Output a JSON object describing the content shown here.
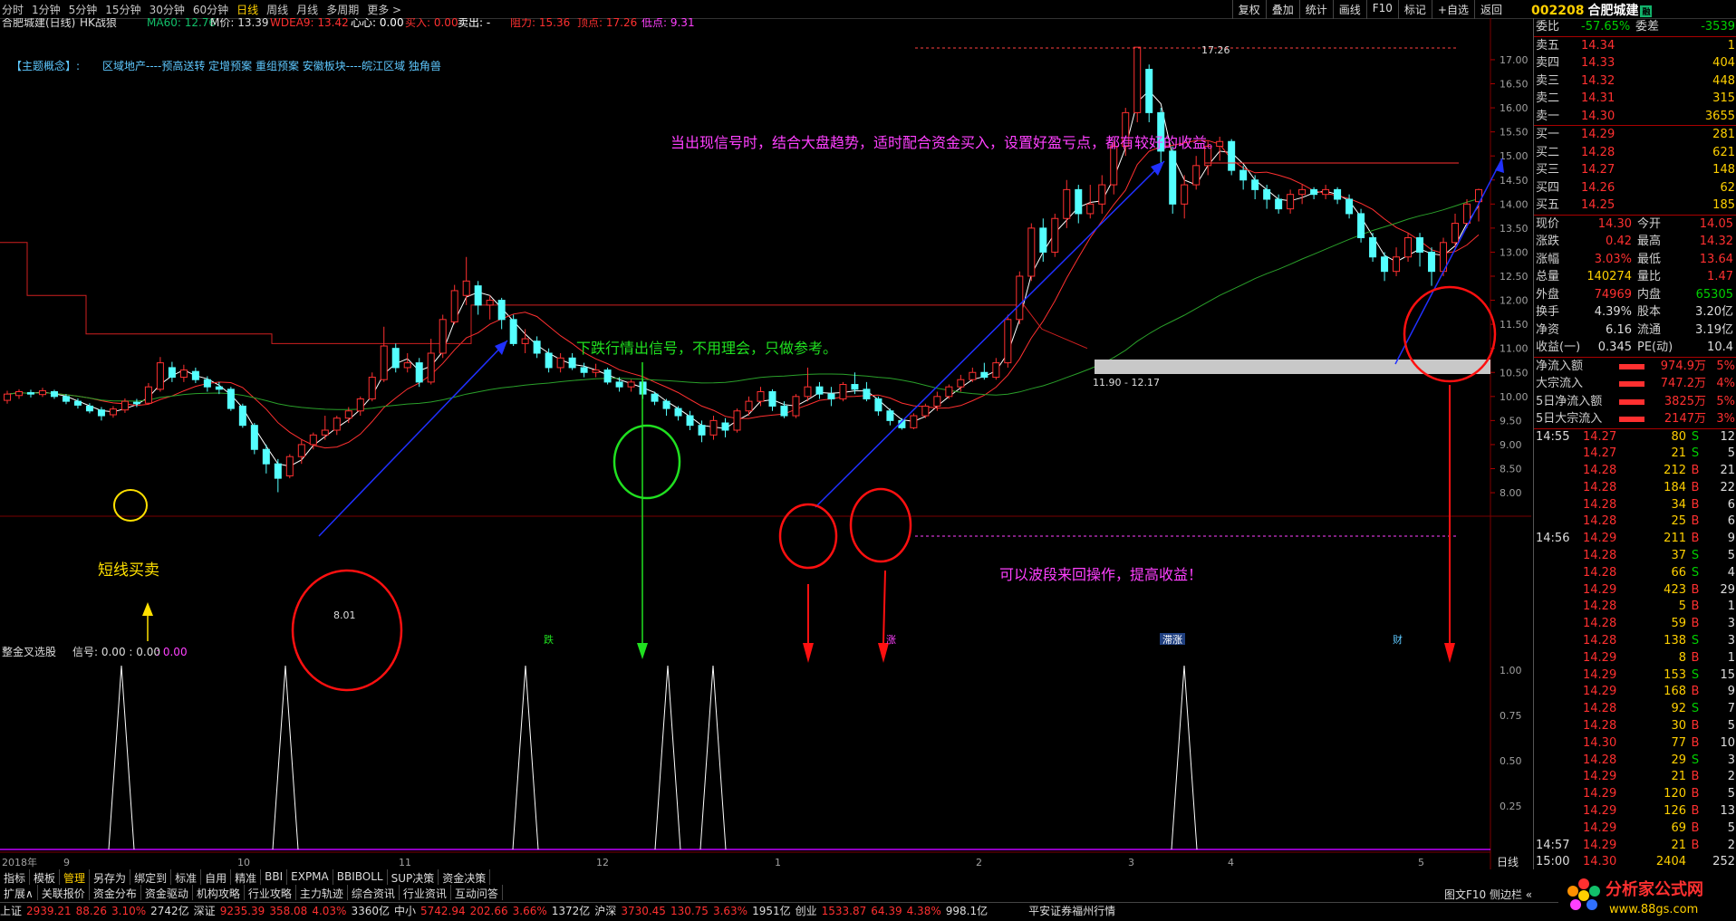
{
  "toolbar": {
    "periods": [
      "分时",
      "1分钟",
      "5分钟",
      "15分钟",
      "30分钟",
      "60分钟",
      "日线",
      "周线",
      "月线",
      "多周期",
      "更多 >"
    ],
    "active_period": "日线",
    "tools": [
      "复权",
      "叠加",
      "统计",
      "画线",
      "F10",
      "标记",
      "+自选",
      "返回"
    ]
  },
  "stock": {
    "code": "002208",
    "name": "合肥城建",
    "badge": "融"
  },
  "legend": {
    "title": "合肥城建(日线)",
    "indicator": "HK战狼",
    "ma60": "MA60: 12.76",
    "mprice": "M价: 13.39",
    "wdea9": "WDEA9: 13.42",
    "xinxin": "心心: 0.00",
    "buy": "买入: 0.00",
    "sell": "卖出: -",
    "zuli": "阻力: 15.36",
    "dingdian": "顶点: 17.26",
    "didian": "低点: 9.31"
  },
  "theme": {
    "label": "【主题概念】:",
    "text": "区域地产----预高送转 定增预案 重组预案 安徽板块----皖江区域 独角兽"
  },
  "annotations": {
    "a1": "当出现信号时，结合大盘趋势，适时配合资金买入，设置好盈亏点，都有较好的收益。",
    "a2": "下跌行情出信号，不用理会，只做参考。",
    "a3": "可以波段来回操作，提高收益！",
    "a4": "短线买卖",
    "peak": "17.26",
    "low": "8.01",
    "range": "11.90 - 12.17"
  },
  "sub_indicator": {
    "title": "整金叉选股",
    "signal": "信号: 0.00 : 0.00",
    "extra": ": 0.00"
  },
  "axis": {
    "main_ticks": [
      "17.00",
      "16.50",
      "16.00",
      "15.50",
      "15.00",
      "14.50",
      "14.00",
      "13.50",
      "13.00",
      "12.50",
      "12.00",
      "11.50",
      "11.00",
      "10.50",
      "10.00",
      "9.50",
      "9.00",
      "8.50",
      "8.00"
    ],
    "sub_ticks": [
      "1.00",
      "0.75",
      "0.50",
      "0.25"
    ],
    "months": [
      "2018年",
      "9",
      "10",
      "11",
      "12",
      "1",
      "2",
      "3",
      "4",
      "5"
    ],
    "period_label": "日线",
    "markers": [
      "跌",
      "涨",
      "滞涨",
      "财"
    ]
  },
  "quote": {
    "weibi_label": "委比",
    "weibi": "-57.65%",
    "weicha_label": "委差",
    "weicha": "-3539",
    "sells": [
      {
        "label": "卖五",
        "price": "14.34",
        "vol": "1"
      },
      {
        "label": "卖四",
        "price": "14.33",
        "vol": "404"
      },
      {
        "label": "卖三",
        "price": "14.32",
        "vol": "448"
      },
      {
        "label": "卖二",
        "price": "14.31",
        "vol": "315"
      },
      {
        "label": "卖一",
        "price": "14.30",
        "vol": "3655"
      }
    ],
    "buys": [
      {
        "label": "买一",
        "price": "14.29",
        "vol": "281"
      },
      {
        "label": "买二",
        "price": "14.28",
        "vol": "621"
      },
      {
        "label": "买三",
        "price": "14.27",
        "vol": "148"
      },
      {
        "label": "买四",
        "price": "14.26",
        "vol": "62"
      },
      {
        "label": "买五",
        "price": "14.25",
        "vol": "185"
      }
    ],
    "stats": [
      {
        "k": "现价",
        "v": "14.30",
        "c": "#ff3030"
      },
      {
        "k": "今开",
        "v": "14.05",
        "c": "#ff3030"
      },
      {
        "k": "涨跌",
        "v": "0.42",
        "c": "#ff3030"
      },
      {
        "k": "最高",
        "v": "14.32",
        "c": "#ff3030"
      },
      {
        "k": "涨幅",
        "v": "3.03%",
        "c": "#ff3030"
      },
      {
        "k": "最低",
        "v": "13.64",
        "c": "#ff3030"
      },
      {
        "k": "总量",
        "v": "140274",
        "c": "#ffd000"
      },
      {
        "k": "量比",
        "v": "1.47",
        "c": "#ff3030"
      },
      {
        "k": "外盘",
        "v": "74969",
        "c": "#ff3030"
      },
      {
        "k": "内盘",
        "v": "65305",
        "c": "#00d000"
      },
      {
        "k": "换手",
        "v": "4.39%",
        "c": "#ddd"
      },
      {
        "k": "股本",
        "v": "3.20亿",
        "c": "#ddd"
      },
      {
        "k": "净资",
        "v": "6.16",
        "c": "#ddd"
      },
      {
        "k": "流通",
        "v": "3.19亿",
        "c": "#ddd"
      },
      {
        "k": "收益(一)",
        "v": "0.345",
        "c": "#ddd"
      },
      {
        "k": "PE(动)",
        "v": "10.4",
        "c": "#ddd"
      }
    ],
    "flows": [
      {
        "k": "净流入额",
        "v": "974.9万",
        "p": "5%"
      },
      {
        "k": "大宗流入",
        "v": "747.2万",
        "p": "4%"
      },
      {
        "k": "5日净流入额",
        "v": "3825万",
        "p": "5%"
      },
      {
        "k": "5日大宗流入",
        "v": "2147万",
        "p": "3%"
      }
    ]
  },
  "ticks": [
    {
      "t": "14:55",
      "p": "14.27",
      "v": "80",
      "bs": "S",
      "n": "12"
    },
    {
      "t": "",
      "p": "14.27",
      "v": "21",
      "bs": "S",
      "n": "5"
    },
    {
      "t": "",
      "p": "14.28",
      "v": "212",
      "bs": "B",
      "n": "21"
    },
    {
      "t": "",
      "p": "14.28",
      "v": "184",
      "bs": "B",
      "n": "22"
    },
    {
      "t": "",
      "p": "14.28",
      "v": "34",
      "bs": "B",
      "n": "6"
    },
    {
      "t": "",
      "p": "14.28",
      "v": "25",
      "bs": "B",
      "n": "6"
    },
    {
      "t": "14:56",
      "p": "14.29",
      "v": "211",
      "bs": "B",
      "n": "9"
    },
    {
      "t": "",
      "p": "14.28",
      "v": "37",
      "bs": "S",
      "n": "5"
    },
    {
      "t": "",
      "p": "14.28",
      "v": "66",
      "bs": "S",
      "n": "4"
    },
    {
      "t": "",
      "p": "14.29",
      "v": "423",
      "bs": "B",
      "n": "29"
    },
    {
      "t": "",
      "p": "14.28",
      "v": "5",
      "bs": "B",
      "n": "1"
    },
    {
      "t": "",
      "p": "14.28",
      "v": "59",
      "bs": "B",
      "n": "3"
    },
    {
      "t": "",
      "p": "14.28",
      "v": "138",
      "bs": "S",
      "n": "3"
    },
    {
      "t": "",
      "p": "14.29",
      "v": "8",
      "bs": "B",
      "n": "1"
    },
    {
      "t": "",
      "p": "14.29",
      "v": "153",
      "bs": "S",
      "n": "15"
    },
    {
      "t": "",
      "p": "14.29",
      "v": "168",
      "bs": "B",
      "n": "9"
    },
    {
      "t": "",
      "p": "14.28",
      "v": "92",
      "bs": "S",
      "n": "7"
    },
    {
      "t": "",
      "p": "14.28",
      "v": "30",
      "bs": "B",
      "n": "5"
    },
    {
      "t": "",
      "p": "14.30",
      "v": "77",
      "bs": "B",
      "n": "10"
    },
    {
      "t": "",
      "p": "14.28",
      "v": "29",
      "bs": "S",
      "n": "3"
    },
    {
      "t": "",
      "p": "14.29",
      "v": "21",
      "bs": "B",
      "n": "2"
    },
    {
      "t": "",
      "p": "14.29",
      "v": "120",
      "bs": "B",
      "n": "5"
    },
    {
      "t": "",
      "p": "14.29",
      "v": "126",
      "bs": "B",
      "n": "13"
    },
    {
      "t": "",
      "p": "14.29",
      "v": "69",
      "bs": "B",
      "n": "5"
    },
    {
      "t": "14:57",
      "p": "14.29",
      "v": "21",
      "bs": "B",
      "n": "2"
    },
    {
      "t": "15:00",
      "p": "14.30",
      "v": "2404",
      "bs": "",
      "n": "252"
    }
  ],
  "tabs_row1": [
    "指标",
    "模板",
    "管理",
    "另存为",
    "绑定到",
    "标准",
    "自用",
    "精准",
    "BBI",
    "EXPMA",
    "BBIBOLL",
    "SUP决策",
    "资金决策"
  ],
  "tabs_row1_active": "管理",
  "tabs_row2": [
    "扩展∧",
    "关联报价",
    "资金分布",
    "资金驱动",
    "机构攻略",
    "行业攻略",
    "主力轨迹",
    "综合资讯",
    "行业资讯",
    "互动问答"
  ],
  "tabs_row2_right": "图文F10  侧边栏 «",
  "status": {
    "items": [
      {
        "n": "上证",
        "v": "2939.21",
        "c": "88.26",
        "p": "3.10%",
        "a": "2742亿"
      },
      {
        "n": "深证",
        "v": "9235.39",
        "c": "358.08",
        "p": "4.03%",
        "a": "3360亿"
      },
      {
        "n": "中小",
        "v": "5742.94",
        "c": "202.66",
        "p": "3.66%",
        "a": "1372亿"
      },
      {
        "n": "沪深",
        "v": "3730.45",
        "c": "130.75",
        "p": "3.63%",
        "a": "1951亿"
      },
      {
        "n": "创业",
        "v": "1533.87",
        "c": "64.39",
        "p": "4.38%",
        "a": "998.1亿"
      }
    ],
    "broker": "平安证券福州行情"
  },
  "logo": {
    "title": "分析家公式网",
    "url": "www.88gs.com"
  },
  "chart_data": {
    "type": "candlestick",
    "ylim": [
      7.7,
      17.3
    ],
    "signal_x": [
      [
        134,
        555
      ],
      [
        315,
        555
      ],
      [
        580,
        555
      ],
      [
        737,
        555
      ],
      [
        787,
        555
      ],
      [
        1307,
        555
      ]
    ],
    "candles": [
      [
        9.92,
        10.05,
        9.85,
        10.12
      ],
      [
        10.02,
        10.1,
        9.95,
        10.15
      ],
      [
        10.08,
        10.05,
        9.98,
        10.14
      ],
      [
        10.04,
        10.12,
        9.99,
        10.18
      ],
      [
        10.1,
        10.0,
        9.95,
        10.14
      ],
      [
        10.0,
        9.9,
        9.84,
        10.05
      ],
      [
        9.9,
        9.82,
        9.75,
        9.96
      ],
      [
        9.8,
        9.7,
        9.65,
        9.86
      ],
      [
        9.72,
        9.6,
        9.5,
        9.78
      ],
      [
        9.62,
        9.74,
        9.56,
        9.8
      ],
      [
        9.72,
        9.9,
        9.66,
        9.96
      ],
      [
        9.88,
        9.85,
        9.78,
        9.95
      ],
      [
        9.86,
        10.2,
        9.84,
        10.28
      ],
      [
        10.15,
        10.7,
        10.1,
        10.82
      ],
      [
        10.6,
        10.4,
        10.3,
        10.72
      ],
      [
        10.4,
        10.55,
        10.3,
        10.66
      ],
      [
        10.52,
        10.35,
        10.28,
        10.6
      ],
      [
        10.35,
        10.2,
        10.1,
        10.42
      ],
      [
        10.2,
        10.15,
        10.05,
        10.3
      ],
      [
        10.15,
        9.75,
        9.7,
        10.2
      ],
      [
        9.8,
        9.4,
        9.35,
        9.85
      ],
      [
        9.4,
        8.9,
        8.8,
        9.45
      ],
      [
        8.9,
        8.6,
        8.4,
        9.0
      ],
      [
        8.6,
        8.3,
        8.01,
        8.7
      ],
      [
        8.35,
        8.75,
        8.3,
        8.8
      ],
      [
        8.75,
        9.0,
        8.6,
        9.1
      ],
      [
        9.0,
        9.2,
        8.9,
        9.25
      ],
      [
        9.2,
        9.3,
        9.1,
        9.6
      ],
      [
        9.3,
        9.55,
        9.2,
        9.6
      ],
      [
        9.55,
        9.7,
        9.45,
        9.78
      ],
      [
        9.7,
        9.95,
        9.6,
        10.0
      ],
      [
        9.95,
        10.4,
        9.9,
        10.5
      ],
      [
        10.35,
        11.05,
        10.3,
        11.45
      ],
      [
        11.0,
        10.6,
        10.5,
        11.1
      ],
      [
        10.6,
        10.7,
        10.5,
        10.9
      ],
      [
        10.7,
        10.3,
        10.2,
        10.8
      ],
      [
        10.3,
        10.9,
        10.25,
        11.2
      ],
      [
        10.9,
        11.6,
        10.8,
        11.7
      ],
      [
        11.55,
        12.2,
        11.5,
        12.32
      ],
      [
        12.1,
        12.4,
        11.9,
        12.9
      ],
      [
        12.3,
        11.9,
        11.7,
        12.4
      ],
      [
        11.9,
        12.0,
        11.6,
        12.1
      ],
      [
        12.0,
        11.6,
        11.4,
        12.05
      ],
      [
        11.6,
        11.1,
        11.05,
        11.7
      ],
      [
        11.1,
        11.2,
        10.9,
        11.4
      ],
      [
        11.15,
        10.9,
        10.8,
        11.25
      ],
      [
        10.9,
        10.6,
        10.5,
        11.0
      ],
      [
        10.6,
        10.8,
        10.5,
        10.9
      ],
      [
        10.8,
        10.6,
        10.55,
        10.9
      ],
      [
        10.6,
        10.5,
        10.4,
        10.7
      ],
      [
        10.5,
        10.55,
        10.4,
        10.68
      ],
      [
        10.55,
        10.3,
        10.25,
        10.6
      ],
      [
        10.3,
        10.2,
        10.1,
        10.4
      ],
      [
        10.2,
        10.3,
        10.1,
        10.35
      ],
      [
        10.3,
        10.05,
        9.95,
        10.35
      ],
      [
        10.05,
        9.9,
        9.82,
        10.1
      ],
      [
        9.9,
        9.75,
        9.6,
        9.95
      ],
      [
        9.75,
        9.6,
        9.5,
        9.8
      ],
      [
        9.6,
        9.4,
        9.3,
        9.7
      ],
      [
        9.4,
        9.2,
        9.05,
        9.5
      ],
      [
        9.2,
        9.5,
        9.1,
        9.6
      ],
      [
        9.45,
        9.3,
        9.15,
        9.55
      ],
      [
        9.3,
        9.7,
        9.25,
        9.75
      ],
      [
        9.7,
        9.9,
        9.6,
        10.0
      ],
      [
        9.9,
        10.1,
        9.8,
        10.2
      ],
      [
        10.1,
        9.8,
        9.7,
        10.15
      ],
      [
        9.8,
        9.6,
        9.55,
        9.9
      ],
      [
        9.6,
        10.0,
        9.55,
        10.05
      ],
      [
        10.0,
        10.2,
        9.9,
        10.6
      ],
      [
        10.2,
        10.05,
        9.95,
        10.3
      ],
      [
        10.05,
        9.95,
        9.8,
        10.2
      ],
      [
        9.95,
        10.25,
        9.9,
        10.3
      ],
      [
        10.25,
        10.15,
        10.05,
        10.5
      ],
      [
        10.15,
        9.95,
        9.9,
        10.3
      ],
      [
        9.95,
        9.7,
        9.6,
        10.0
      ],
      [
        9.7,
        9.5,
        9.4,
        9.75
      ],
      [
        9.5,
        9.35,
        9.31,
        9.55
      ],
      [
        9.35,
        9.6,
        9.32,
        9.65
      ],
      [
        9.6,
        9.8,
        9.55,
        9.85
      ],
      [
        9.8,
        10.0,
        9.7,
        10.1
      ],
      [
        10.0,
        10.2,
        9.95,
        10.25
      ],
      [
        10.2,
        10.35,
        10.1,
        10.45
      ],
      [
        10.35,
        10.5,
        10.3,
        10.6
      ],
      [
        10.5,
        10.4,
        10.35,
        10.7
      ],
      [
        10.4,
        10.7,
        10.35,
        10.8
      ],
      [
        10.7,
        11.6,
        10.6,
        11.7
      ],
      [
        11.6,
        12.5,
        11.5,
        12.6
      ],
      [
        12.5,
        13.5,
        12.4,
        13.6
      ],
      [
        13.5,
        13.0,
        12.8,
        13.7
      ],
      [
        13.0,
        13.7,
        12.9,
        13.8
      ],
      [
        13.7,
        14.3,
        13.5,
        14.5
      ],
      [
        14.3,
        13.8,
        13.6,
        14.4
      ],
      [
        13.8,
        14.0,
        13.7,
        14.4
      ],
      [
        14.0,
        14.4,
        13.8,
        14.6
      ],
      [
        14.4,
        15.2,
        14.2,
        15.3
      ],
      [
        15.2,
        15.9,
        15.0,
        16.0
      ],
      [
        15.9,
        17.26,
        15.7,
        17.26
      ],
      [
        16.8,
        15.9,
        15.7,
        16.9
      ],
      [
        15.9,
        15.1,
        14.8,
        16.0
      ],
      [
        15.1,
        14.0,
        13.8,
        15.2
      ],
      [
        14.0,
        14.4,
        13.7,
        14.6
      ],
      [
        14.4,
        14.8,
        14.3,
        15.0
      ],
      [
        14.8,
        15.2,
        14.6,
        15.3
      ],
      [
        15.2,
        15.3,
        14.9,
        15.4
      ],
      [
        15.3,
        14.7,
        14.6,
        15.35
      ],
      [
        14.7,
        14.5,
        14.3,
        14.8
      ],
      [
        14.5,
        14.3,
        14.1,
        14.6
      ],
      [
        14.3,
        14.1,
        13.9,
        14.4
      ],
      [
        14.1,
        13.9,
        13.8,
        14.2
      ],
      [
        13.9,
        14.2,
        13.8,
        14.3
      ],
      [
        14.2,
        14.3,
        14.0,
        14.4
      ],
      [
        14.3,
        14.2,
        14.1,
        14.35
      ],
      [
        14.2,
        14.3,
        14.1,
        14.4
      ],
      [
        14.3,
        14.1,
        14.0,
        14.35
      ],
      [
        14.1,
        13.8,
        13.7,
        14.2
      ],
      [
        13.8,
        13.3,
        13.2,
        13.9
      ],
      [
        13.3,
        12.9,
        12.8,
        13.4
      ],
      [
        12.9,
        12.6,
        12.4,
        13.0
      ],
      [
        12.6,
        12.9,
        12.5,
        13.1
      ],
      [
        12.9,
        13.3,
        12.8,
        13.4
      ],
      [
        13.3,
        13.0,
        12.7,
        13.4
      ],
      [
        13.0,
        12.6,
        12.3,
        13.1
      ],
      [
        12.6,
        13.2,
        12.5,
        13.3
      ],
      [
        13.2,
        13.6,
        13.1,
        13.8
      ],
      [
        13.6,
        14.0,
        13.5,
        14.1
      ],
      [
        14.05,
        14.3,
        13.64,
        14.32
      ]
    ]
  }
}
